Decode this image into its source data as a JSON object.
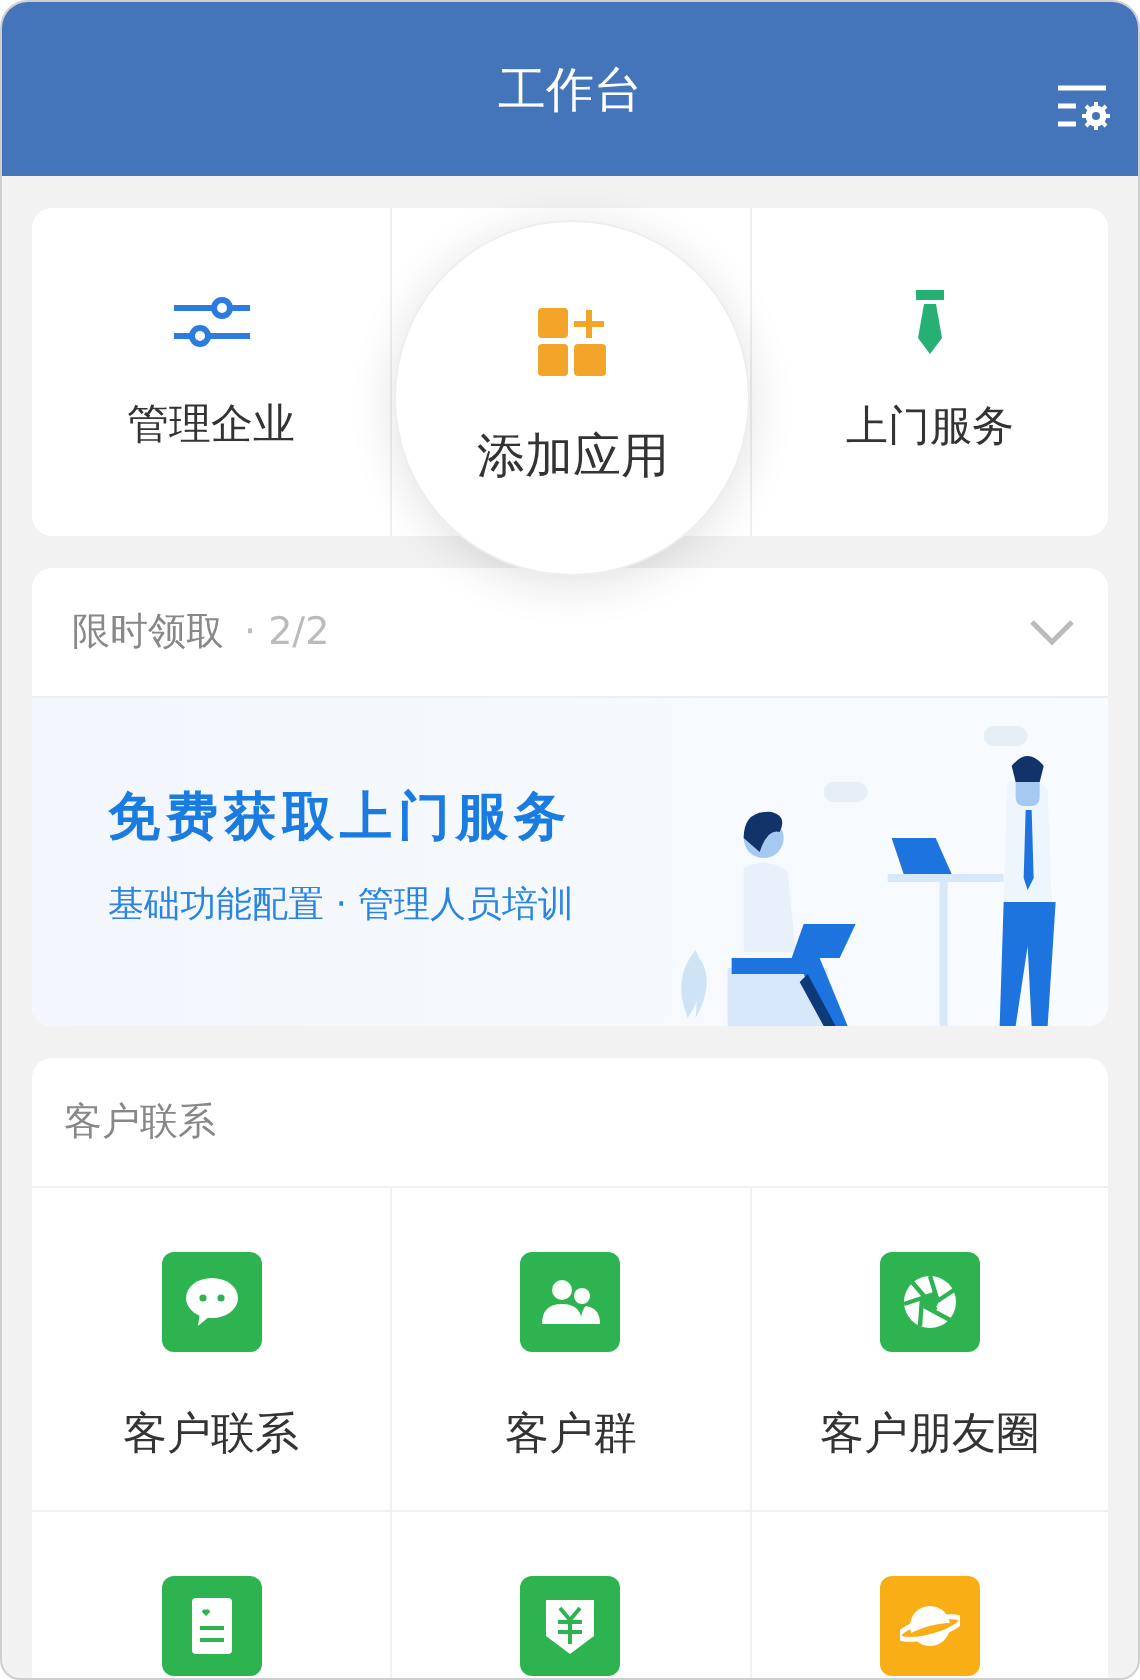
{
  "header": {
    "title": "工作台"
  },
  "quick_actions": [
    {
      "label": "管理企业",
      "highlighted": false
    },
    {
      "label": "添加应用",
      "highlighted": true
    },
    {
      "label": "上门服务",
      "highlighted": false
    }
  ],
  "promo": {
    "title": "限时领取",
    "counter": "· 2/2",
    "expanded": false,
    "banner": {
      "title": "免费获取上门服务",
      "subtitle": "基础功能配置 · 管理人员培训"
    }
  },
  "customer_section": {
    "title": "客户联系",
    "apps": [
      {
        "label": "客户联系",
        "color": "#2db451"
      },
      {
        "label": "客户群",
        "color": "#2db451"
      },
      {
        "label": "客户朋友圈",
        "color": "#2db451"
      },
      {
        "color": "#2db451"
      },
      {
        "color": "#2db451"
      },
      {
        "color": "#f9ae15"
      }
    ]
  }
}
